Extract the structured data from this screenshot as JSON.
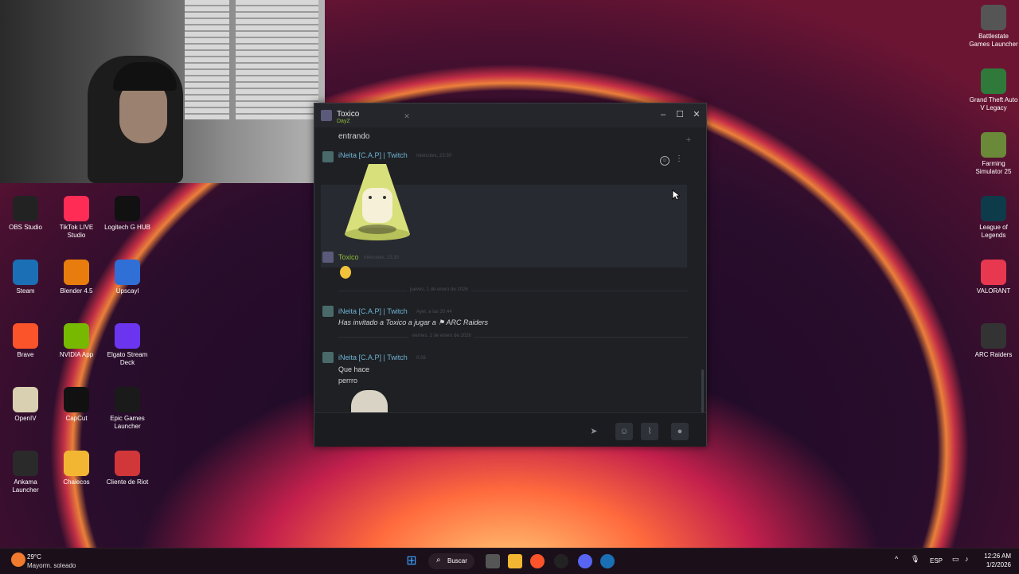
{
  "desktop_icons_left": [
    {
      "label": "OBS Studio",
      "icon": "obs-icon",
      "col": 0,
      "row": 0,
      "color": "#222"
    },
    {
      "label": "TikTok LIVE Studio",
      "icon": "tiktok-icon",
      "col": 1,
      "row": 0,
      "color": "#ff2d55"
    },
    {
      "label": "Logitech G HUB",
      "icon": "logitech-icon",
      "col": 2,
      "row": 0,
      "color": "#111"
    },
    {
      "label": "Steam",
      "icon": "steam-icon",
      "col": 0,
      "row": 1,
      "color": "#1b6fb5"
    },
    {
      "label": "Blender 4.5",
      "icon": "blender-icon",
      "col": 1,
      "row": 1,
      "color": "#e87d0d"
    },
    {
      "label": "Upscayl",
      "icon": "upscayl-icon",
      "col": 2,
      "row": 1,
      "color": "#2f6fd6"
    },
    {
      "label": "Brave",
      "icon": "brave-icon",
      "col": 0,
      "row": 2,
      "color": "#fb542b"
    },
    {
      "label": "NVIDIA App",
      "icon": "nvidia-icon",
      "col": 1,
      "row": 2,
      "color": "#76b900"
    },
    {
      "label": "Elgato Stream Deck",
      "icon": "streamdeck-icon",
      "col": 2,
      "row": 2,
      "color": "#6b35f0"
    },
    {
      "label": "OpenIV",
      "icon": "openiv-icon",
      "col": 0,
      "row": 3,
      "color": "#d8d0b0"
    },
    {
      "label": "CapCut",
      "icon": "capcut-icon",
      "col": 1,
      "row": 3,
      "color": "#111"
    },
    {
      "label": "Epic Games Launcher",
      "icon": "epic-icon",
      "col": 2,
      "row": 3,
      "color": "#1a1a1a"
    },
    {
      "label": "Ankama Launcher",
      "icon": "ankama-icon",
      "col": 0,
      "row": 4,
      "color": "#2a2a2a"
    },
    {
      "label": "Chalecos",
      "icon": "folder-icon",
      "col": 1,
      "row": 4,
      "color": "#f2b632"
    },
    {
      "label": "Cliente de Riot",
      "icon": "riot-icon",
      "col": 2,
      "row": 4,
      "color": "#d13639"
    }
  ],
  "desktop_icons_right": [
    {
      "label": "Battlestate Games Launcher",
      "icon": "battlestate-icon",
      "color": "#555"
    },
    {
      "label": "Grand Theft Auto V Legacy",
      "icon": "gta-icon",
      "color": "#2f7a3a"
    },
    {
      "label": "Farming Simulator 25",
      "icon": "farming-icon",
      "color": "#6a8a3a"
    },
    {
      "label": "League of Legends",
      "icon": "lol-icon",
      "color": "#0e3b4a"
    },
    {
      "label": "VALORANT",
      "icon": "valorant-icon",
      "color": "#e8384f"
    },
    {
      "label": "ARC Raiders",
      "icon": "arc-raiders-icon",
      "color": "#333"
    }
  ],
  "chat": {
    "title": "Toxico",
    "subtitle": "DayZ",
    "first_message": "entrando",
    "messages": [
      {
        "author": "iNeita [C.A.P] | Twitch",
        "time": "miércoles, 23:30",
        "type": "sticker"
      },
      {
        "author": "Toxico",
        "time": "miércoles, 23:30",
        "type": "emoji"
      },
      {
        "divider": "jueves, 1 de enero de 2026"
      },
      {
        "author": "iNeita [C.A.P] | Twitch",
        "time": "Ayer, a las 20:44",
        "text": "Has invitado a Toxico a jugar a",
        "game": "ARC Raiders"
      },
      {
        "divider": "viernes, 2 de enero de 2026"
      },
      {
        "author": "iNeita [C.A.P] | Twitch",
        "time": "0:26",
        "lines": [
          "Que hace",
          "perrro"
        ]
      }
    ]
  },
  "taskbar": {
    "weather_temp": "29°C",
    "weather_desc": "Mayorm. soleado",
    "search_label": "Buscar",
    "lang": "ESP",
    "time": "12:26 AM",
    "date": "1/2/2026"
  }
}
